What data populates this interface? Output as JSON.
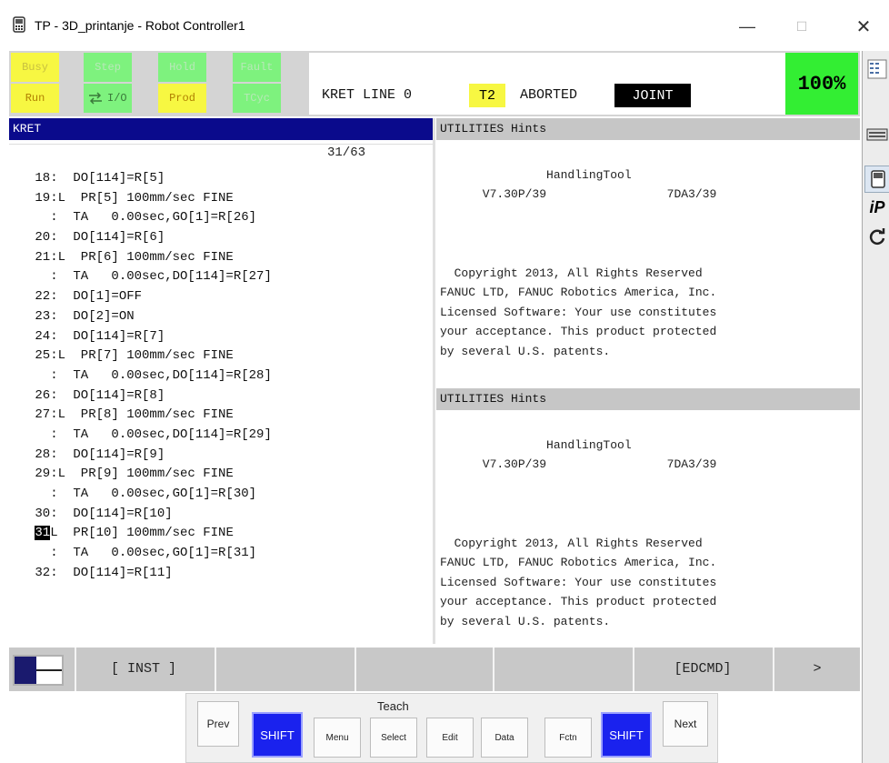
{
  "window": {
    "title": "TP - 3D_printanje - Robot Controller1",
    "minimize": "—",
    "maximize": "☐",
    "close": "✕"
  },
  "status": {
    "indicators": [
      {
        "label": "Busy",
        "color": "#f7f742"
      },
      {
        "label": "Step",
        "color": "#7ef27e"
      },
      {
        "label": "Hold",
        "color": "#7ef27e"
      },
      {
        "label": "Fault",
        "color": "#f7f742"
      },
      {
        "label": "Run",
        "color": "#f7f742"
      },
      {
        "label": "I/O",
        "color": "#7ef27e"
      },
      {
        "label": "Prod",
        "color": "#f7f742"
      },
      {
        "label": "TCyc",
        "color": "#f7f742"
      }
    ],
    "program_line": "KRET LINE 0",
    "mode": "T2",
    "state": "ABORTED",
    "coord": "JOINT",
    "override": "100%"
  },
  "program": {
    "name": "KRET",
    "position": "31/63",
    "lines": [
      " 18:  DO[114]=R[5]",
      " 19:L  PR[5] 100mm/sec FINE",
      "   :  TA   0.00sec,GO[1]=R[26]",
      " 20:  DO[114]=R[6]",
      " 21:L  PR[6] 100mm/sec FINE",
      "   :  TA   0.00sec,DO[114]=R[27]",
      " 22:  DO[1]=OFF",
      " 23:  DO[2]=ON",
      " 24:  DO[114]=R[7]",
      " 25:L  PR[7] 100mm/sec FINE",
      "   :  TA   0.00sec,DO[114]=R[28]",
      " 26:  DO[114]=R[8]",
      " 27:L  PR[8] 100mm/sec FINE",
      "   :  TA   0.00sec,DO[114]=R[29]",
      " 28:  DO[114]=R[9]",
      " 29:L  PR[9] 100mm/sec FINE",
      "   :  TA   0.00sec,GO[1]=R[30]",
      " 30:  DO[114]=R[10]",
      "L  PR[10] 100mm/sec FINE",
      "   :  TA   0.00sec,GO[1]=R[31]",
      " 32:  DO[114]=R[11]"
    ],
    "current_line": "31"
  },
  "hints": [
    {
      "title": "UTILITIES Hints",
      "lines": [
        "",
        "               HandlingTool",
        "      V7.30P/39                 7DA3/39",
        "",
        "",
        "",
        "  Copyright 2013, All Rights Reserved",
        "FANUC LTD, FANUC Robotics America, Inc.",
        "Licensed Software: Your use constitutes",
        "your acceptance. This product protected",
        "by several U.S. patents."
      ]
    },
    {
      "title": "UTILITIES Hints",
      "lines": [
        "",
        "               HandlingTool",
        "      V7.30P/39                 7DA3/39",
        "",
        "",
        "",
        "  Copyright 2013, All Rights Reserved",
        "FANUC LTD, FANUC Robotics America, Inc.",
        "Licensed Software: Your use constitutes",
        "your acceptance. This product protected",
        "by several U.S. patents."
      ]
    }
  ],
  "function_keys": {
    "f1": "[ INST ]",
    "f2": "",
    "f3": "",
    "f4": "",
    "f5": "[EDCMD]",
    "next": ">"
  },
  "keypad": {
    "teach_label": "Teach",
    "prev": "Prev",
    "shift_left": "SHIFT",
    "menu": "Menu",
    "select": "Select",
    "edit": "Edit",
    "data": "Data",
    "fctn": "Fctn",
    "shift_right": "SHIFT",
    "next": "Next"
  },
  "sidebar": {
    "ip_label": "iP"
  }
}
